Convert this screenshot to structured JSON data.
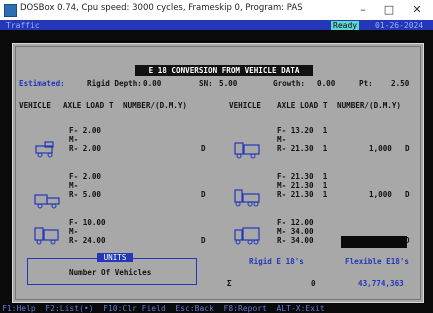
{
  "window": {
    "title": "DOSBox 0.74, Cpu speed:   3000 cycles, Frameskip 0, Program:    PAS",
    "minimize": "–",
    "maximize": "□",
    "close": "✕"
  },
  "topbar": {
    "label": "Traffic",
    "ready": "Ready",
    "date": "01-26-2024"
  },
  "report": {
    "header": "E 18 CONVERSION FROM VEHICLE DATA",
    "estimated_label": "Estimated:",
    "rigid_depth_label": "Rigid Depth:",
    "rigid_depth_value": "0.00",
    "sn_label": "SN:",
    "sn_value": "5.00",
    "growth_label": "Growth:",
    "growth_value": "0.00",
    "pt_label": "Pt:",
    "pt_value": "2.50",
    "columns": [
      "VEHICLE",
      "AXLE LOAD",
      "T",
      "NUMBER/(D.M.Y)",
      "VEHICLE",
      "AXLE LOAD",
      "T",
      "NUMBER/(D.M.Y)"
    ],
    "rows": [
      {
        "left": {
          "F": "F- 2.00",
          "M": "M-",
          "R": "R- 2.00",
          "t": "",
          "number": "",
          "unit": "D"
        },
        "right": {
          "F": "F- 13.20  1",
          "M": "M-",
          "R": "R- 21.30  1",
          "t": "",
          "number": "1,000",
          "unit": "D"
        }
      },
      {
        "left": {
          "F": "F- 2.00",
          "M": "M-",
          "R": "R- 5.00",
          "t": "",
          "number": "",
          "unit": "D"
        },
        "right": {
          "F": "F- 21.30  1",
          "M": "M- 21.30  1",
          "R": "R- 21.30  1",
          "t": "",
          "number": "1,000",
          "unit": "D"
        }
      },
      {
        "left": {
          "F": "F- 10.00",
          "M": "M-",
          "R": "R- 24.00",
          "t": "",
          "number": "",
          "unit": "D"
        },
        "right": {
          "F": "F- 12.00",
          "M": "M- 34.00",
          "R": "R- 34.00",
          "t": "",
          "number": "",
          "unit": "D"
        }
      }
    ],
    "units_label": "UNITS",
    "units_value": "Number Of Vehicles",
    "rigid_e18_label": "Rigid E 18's",
    "flexible_e18_label": "Flexible E18's",
    "sigma": "Σ",
    "rigid_total": "0",
    "flexible_total": "43,774,363"
  },
  "statusline": "F1:Help  F2:List(•)  F10:Clr Field  Esc:Back  F8:Report  ALT-X:Exit"
}
